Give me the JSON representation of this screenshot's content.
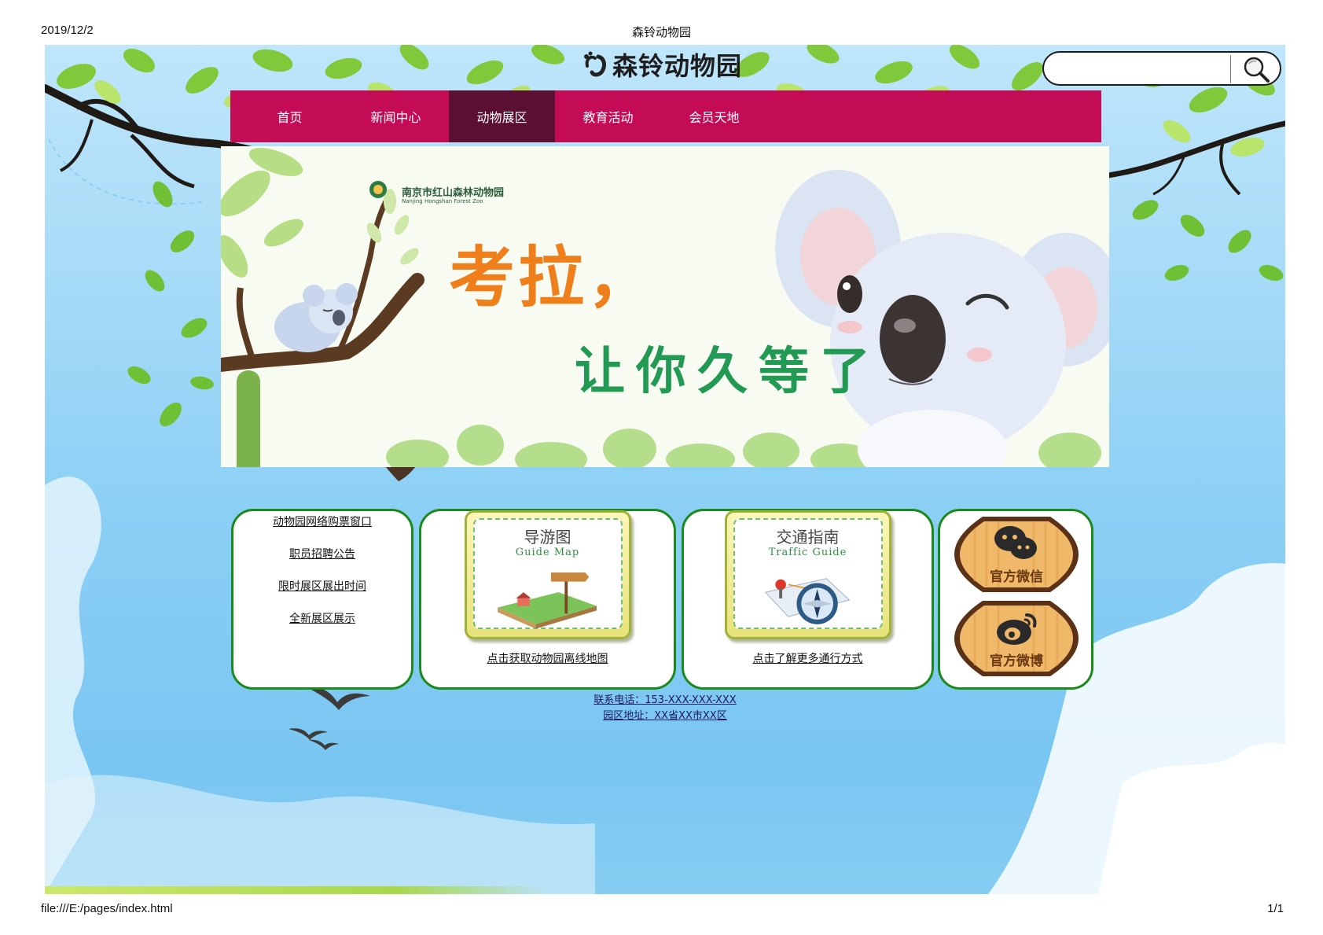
{
  "print": {
    "date": "2019/12/2",
    "title": "森铃动物园",
    "url": "file:///E:/pages/index.html",
    "page": "1/1"
  },
  "site": {
    "logo_text": "森铃动物园",
    "search_placeholder": ""
  },
  "nav": {
    "items": [
      {
        "label": "首页",
        "active": false
      },
      {
        "label": "新闻中心",
        "active": false
      },
      {
        "label": "动物展区",
        "active": true
      },
      {
        "label": "教育活动",
        "active": false
      },
      {
        "label": "会员天地",
        "active": false
      }
    ]
  },
  "banner": {
    "zoo_name": "南京市红山森林动物园",
    "zoo_name_en": "Nanjing Hongshan Forest Zoo",
    "line1": "考拉，",
    "line2": "让你久等了"
  },
  "links": [
    "动物园网络购票窗口",
    "职员招聘公告",
    "限时展区展出时间",
    "全新展区展示"
  ],
  "map_card": {
    "title": "导游图",
    "subtitle": "Guide Map",
    "link": "点击获取动物园离线地图"
  },
  "traffic_card": {
    "title": "交通指南",
    "subtitle": "Traffic Guide",
    "link": "点击了解更多通行方式"
  },
  "social": {
    "wechat": "官方微信",
    "weibo": "官方微博"
  },
  "contact": {
    "phone": "联系电话：153-XXX-XXX-XXX",
    "address": "园区地址：XX省XX市XX区"
  },
  "colors": {
    "nav_bg": "#c40b56",
    "nav_active": "#5a0f33",
    "box_border": "#1b8a1b"
  }
}
